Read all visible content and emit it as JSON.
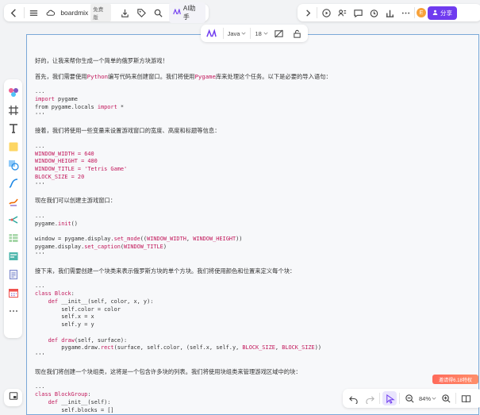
{
  "app": {
    "name": "boardmix",
    "plan_badge": "免费版",
    "ai_label": "AI助手",
    "avatar_initial": "E",
    "share_label": "分享"
  },
  "code_toolbar": {
    "language": "Java",
    "font_size": "18"
  },
  "zoom": {
    "value": "84%"
  },
  "promo": {
    "label": "邀请得6.18特权"
  },
  "colors": {
    "accent": "#6f3bef",
    "keyword": "#c2185b",
    "block_border": "#7aa8d8"
  },
  "content": [
    {
      "type": "prose",
      "text": "好的，让我来帮你生成一个简单的俄罗斯方块游戏！"
    },
    {
      "type": "blank"
    },
    {
      "type": "prose_mixed",
      "parts": [
        {
          "t": "首先，我们需要使用"
        },
        {
          "t": "Python",
          "hl": true
        },
        {
          "t": "编写代码来创建窗口。我们将使用"
        },
        {
          "t": "Pygame",
          "hl": true
        },
        {
          "t": "库来处理这个任务。以下是必要的导入语句："
        }
      ]
    },
    {
      "type": "blank"
    },
    {
      "type": "code",
      "parts": [
        {
          "t": "..."
        }
      ]
    },
    {
      "type": "code",
      "parts": [
        {
          "t": "import",
          "c": "kw"
        },
        {
          "t": " pygame"
        }
      ]
    },
    {
      "type": "code",
      "parts": [
        {
          "t": "from pygame.locals "
        },
        {
          "t": "import",
          "c": "kw"
        },
        {
          "t": " *"
        }
      ]
    },
    {
      "type": "code",
      "parts": [
        {
          "t": "'''"
        }
      ]
    },
    {
      "type": "blank"
    },
    {
      "type": "prose",
      "text": "接着，我们将使用一些变量来设置游戏窗口的宽度、高度和标题等信息："
    },
    {
      "type": "blank"
    },
    {
      "type": "code",
      "parts": [
        {
          "t": "..."
        }
      ]
    },
    {
      "type": "code",
      "parts": [
        {
          "t": "WINDOW_WIDTH = 640",
          "c": "kw"
        }
      ]
    },
    {
      "type": "code",
      "parts": [
        {
          "t": "WINDOW_HEIGHT = 480",
          "c": "kw"
        }
      ]
    },
    {
      "type": "code",
      "parts": [
        {
          "t": "WINDOW_TITLE = ",
          "c": "kw"
        },
        {
          "t": "'Tetris Game'",
          "c": "str"
        }
      ]
    },
    {
      "type": "code",
      "parts": [
        {
          "t": "BLOCK_SIZE = 20",
          "c": "kw"
        }
      ]
    },
    {
      "type": "code",
      "parts": [
        {
          "t": "'''"
        }
      ]
    },
    {
      "type": "blank"
    },
    {
      "type": "prose",
      "text": "现在我们可以创建主游戏窗口："
    },
    {
      "type": "blank"
    },
    {
      "type": "code",
      "parts": [
        {
          "t": "..."
        }
      ]
    },
    {
      "type": "code",
      "parts": [
        {
          "t": "pygame."
        },
        {
          "t": "init",
          "c": "fn"
        },
        {
          "t": "()"
        }
      ]
    },
    {
      "type": "blank"
    },
    {
      "type": "code",
      "parts": [
        {
          "t": "window = pygame.display."
        },
        {
          "t": "set_mode",
          "c": "fn"
        },
        {
          "t": "(("
        },
        {
          "t": "WINDOW_WIDTH",
          "c": "kw"
        },
        {
          "t": ", "
        },
        {
          "t": "WINDOW_HEIGHT",
          "c": "kw"
        },
        {
          "t": "))"
        }
      ]
    },
    {
      "type": "code",
      "parts": [
        {
          "t": "pygame.display."
        },
        {
          "t": "set_caption",
          "c": "fn"
        },
        {
          "t": "("
        },
        {
          "t": "WINDOW_TITLE",
          "c": "kw"
        },
        {
          "t": ")"
        }
      ]
    },
    {
      "type": "code",
      "parts": [
        {
          "t": "'''"
        }
      ]
    },
    {
      "type": "blank"
    },
    {
      "type": "prose",
      "text": "接下来，我们需要创建一个块类来表示俄罗斯方块的单个方块。我们将使用颜色和位置来定义每个块："
    },
    {
      "type": "blank"
    },
    {
      "type": "code",
      "parts": [
        {
          "t": "..."
        }
      ]
    },
    {
      "type": "code",
      "parts": [
        {
          "t": "class",
          "c": "kw"
        },
        {
          "t": " "
        },
        {
          "t": "Block",
          "c": "fn"
        },
        {
          "t": ":"
        }
      ]
    },
    {
      "type": "code",
      "parts": [
        {
          "t": "    "
        },
        {
          "t": "def",
          "c": "kw"
        },
        {
          "t": " __init__(self, color, x, y):"
        }
      ]
    },
    {
      "type": "code",
      "parts": [
        {
          "t": "        self.color = color"
        }
      ]
    },
    {
      "type": "code",
      "parts": [
        {
          "t": "        self.x = x"
        }
      ]
    },
    {
      "type": "code",
      "parts": [
        {
          "t": "        self.y = y"
        }
      ]
    },
    {
      "type": "blank"
    },
    {
      "type": "code",
      "parts": [
        {
          "t": "    "
        },
        {
          "t": "def",
          "c": "kw"
        },
        {
          "t": " "
        },
        {
          "t": "draw",
          "c": "fn"
        },
        {
          "t": "(self, surface):"
        }
      ]
    },
    {
      "type": "code",
      "parts": [
        {
          "t": "        pygame.draw."
        },
        {
          "t": "rect",
          "c": "fn"
        },
        {
          "t": "(surface, self.color, (self.x, self.y, "
        },
        {
          "t": "BLOCK_SIZE",
          "c": "kw"
        },
        {
          "t": ", "
        },
        {
          "t": "BLOCK_SIZE",
          "c": "kw"
        },
        {
          "t": "))"
        }
      ]
    },
    {
      "type": "code",
      "parts": [
        {
          "t": "'''"
        }
      ]
    },
    {
      "type": "blank"
    },
    {
      "type": "prose",
      "text": "现在我们将创建一个块组类，这将是一个包含许多块的列表。我们将使用块组类来管理游戏区域中的块："
    },
    {
      "type": "blank"
    },
    {
      "type": "code",
      "parts": [
        {
          "t": "..."
        }
      ]
    },
    {
      "type": "code",
      "parts": [
        {
          "t": "class",
          "c": "kw"
        },
        {
          "t": " "
        },
        {
          "t": "BlockGroup",
          "c": "fn"
        },
        {
          "t": ":"
        }
      ]
    },
    {
      "type": "code",
      "parts": [
        {
          "t": "    "
        },
        {
          "t": "def",
          "c": "kw"
        },
        {
          "t": " __init__(self):"
        }
      ]
    },
    {
      "type": "code",
      "parts": [
        {
          "t": "        self.blocks = []"
        }
      ]
    }
  ]
}
